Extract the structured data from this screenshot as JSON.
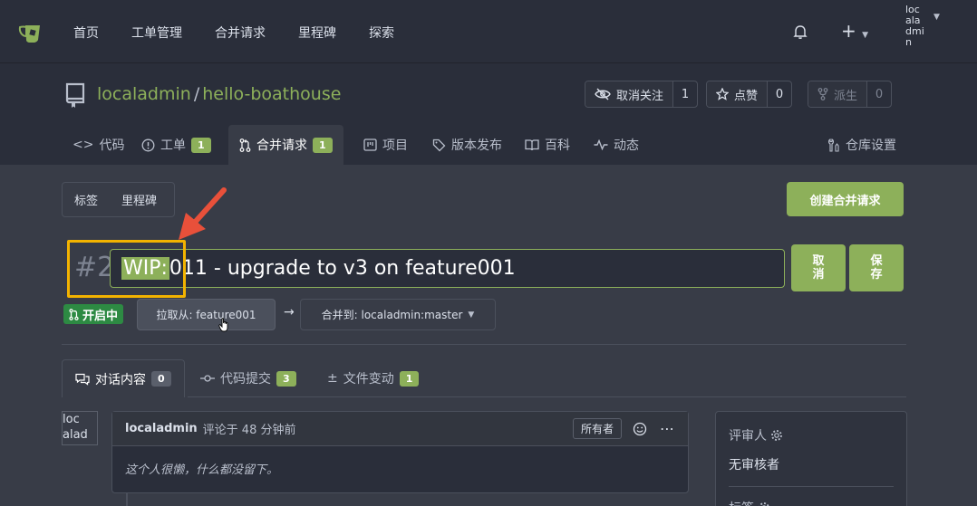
{
  "nav": {
    "items": [
      "首页",
      "工单管理",
      "合并请求",
      "里程碑",
      "探索"
    ],
    "avatar_alt": "localadmin"
  },
  "repo": {
    "owner": "localadmin",
    "name": "hello-boathouse",
    "unwatch_label": "取消关注",
    "watch_count": "1",
    "star_label": "点赞",
    "star_count": "0",
    "fork_label": "派生",
    "fork_count": "0"
  },
  "tabs": {
    "code": "代码",
    "issues": "工单",
    "issues_count": "1",
    "pulls": "合并请求",
    "pulls_count": "1",
    "projects": "项目",
    "releases": "版本发布",
    "wiki": "百科",
    "activity": "动态",
    "settings": "仓库设置"
  },
  "toolbar": {
    "labels": "标签",
    "milestones": "里程碑",
    "create_pr": "创建合并请求"
  },
  "pr": {
    "number": "#2",
    "title_selected": "WIP: ",
    "title_rest": "011 - upgrade to v3 on feature001",
    "cancel": "取消",
    "save": "保存",
    "state": "开启中",
    "from_branch": "拉取从: feature001",
    "to_branch": "合并到: localadmin:master"
  },
  "subtabs": {
    "conversation": "对话内容",
    "conversation_count": "0",
    "commits": "代码提交",
    "commits_count": "3",
    "files": "文件变动",
    "files_count": "1"
  },
  "comment": {
    "avatar_alt": "loc alad",
    "author": "localadmin",
    "meta": "评论于 48 分钟前",
    "owner_tag": "所有者",
    "body": "这个人很懒，什么都没留下。"
  },
  "sidebar": {
    "reviewers_title": "评审人",
    "reviewers_value": "无审核者",
    "labels_title": "标签"
  },
  "colors": {
    "accent": "#8db05a",
    "highlight": "#f3b300",
    "arrow": "#e8503a"
  }
}
